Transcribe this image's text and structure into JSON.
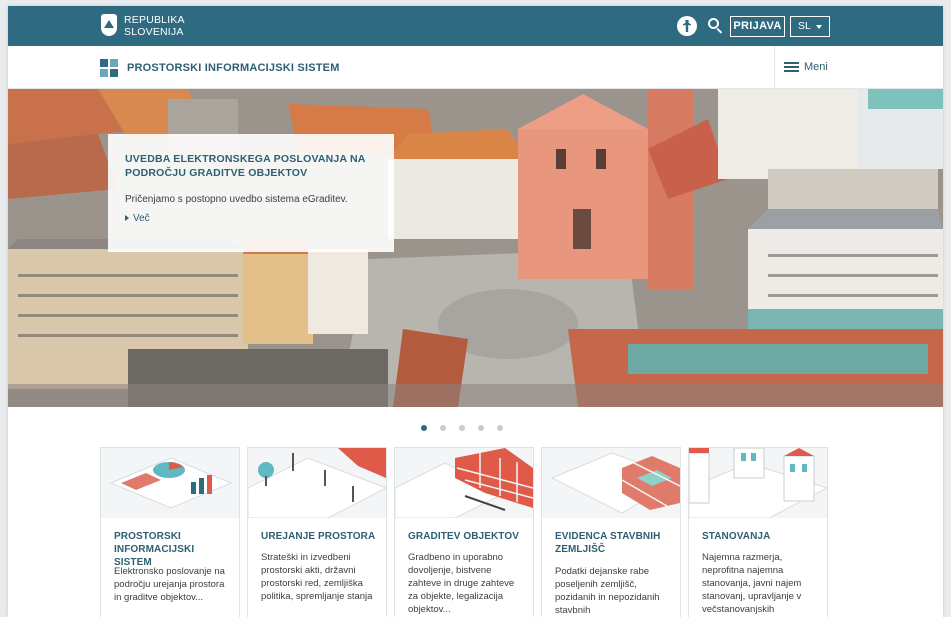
{
  "topbar": {
    "brand_line1": "REPUBLIKA",
    "brand_line2": "SLOVENIJA",
    "login_label": "PRIJAVA",
    "language": "SL",
    "icons": [
      "accessibility-icon",
      "search-icon"
    ],
    "color": "#2e6b80"
  },
  "subbar": {
    "site_title": "PROSTORSKI INFORMACIJSKI SISTEM",
    "menu_label": "Meni"
  },
  "hero": {
    "title": "UVEDBA ELEKTRONSKEGA POSLOVANJA NA PODROČJU GRADITVE OBJEKTOV",
    "text": "Pričenjamo s postopno uvedbo sistema eGraditev.",
    "more_label": "Več",
    "slides_total": 5,
    "active_slide": 1
  },
  "cards": [
    {
      "title": "PROSTORSKI INFORMACIJSKI SISTEM",
      "text": "Elektronsko poslovanje na področju urejanja prostora in graditve objektov..."
    },
    {
      "title": "UREJANJE PROSTORA",
      "text": "Strateški in izvedbeni prostorski akti, državni prostorski red, zemljiška politika, spremljanje stanja"
    },
    {
      "title": "GRADITEV OBJEKTOV",
      "text": "Gradbeno in uporabno dovoljenje, bistvene zahteve in druge zahteve za objekte, legalizacija objektov..."
    },
    {
      "title": "EVIDENCA STAVBNIH ZEMLJIŠČ",
      "text": "Podatki dejanske rabe poseljenih zemljišč, pozidanih in nepozidanih stavbnih"
    },
    {
      "title": "STANOVANJA",
      "text": "Najemna razmerja, neprofitna najemna stanovanja, javni najem stanovanj, upravljanje v večstanovanjskih"
    }
  ]
}
